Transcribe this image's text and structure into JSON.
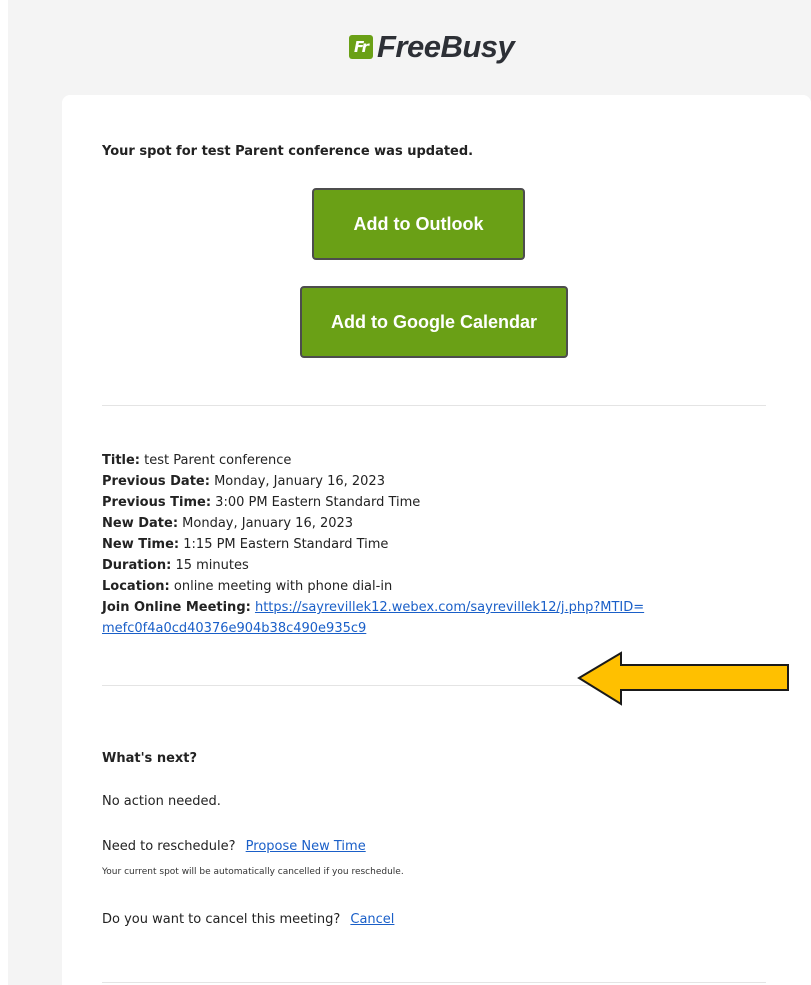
{
  "brand": {
    "mark_glyph": "Fr",
    "name": "FreeBusy",
    "mark_color": "#6aa016"
  },
  "email": {
    "headline": "Your spot for test Parent conference was updated.",
    "buttons": {
      "outlook": "Add to Outlook",
      "google": "Add to Google Calendar"
    },
    "details": {
      "title_label": "Title:",
      "title_value": "test Parent conference",
      "prev_date_label": "Previous Date:",
      "prev_date_value": "Monday, January 16, 2023",
      "prev_time_label": "Previous Time:",
      "prev_time_value": "3:00 PM Eastern Standard Time",
      "new_date_label": "New Date:",
      "new_date_value": "Monday, January 16, 2023",
      "new_time_label": "New Time:",
      "new_time_value": "1:15 PM Eastern Standard Time",
      "duration_label": "Duration:",
      "duration_value": "15 minutes",
      "location_label": "Location:",
      "location_value": "online meeting with phone dial-in",
      "join_label": "Join Online Meeting:",
      "join_url_line1": "https://sayrevillek12.webex.com/sayrevillek12/j.php?MTID=",
      "join_url_line2": "mefc0f4a0cd40376e904b38c490e935c9"
    },
    "next": {
      "heading": "What's next?",
      "no_action": "No action needed.",
      "reschedule_question": "Need to reschedule?",
      "reschedule_link": "Propose New Time",
      "reschedule_note": "Your current spot will be automatically cancelled if you reschedule.",
      "cancel_question": "Do you want to cancel this meeting?",
      "cancel_link": "Cancel"
    }
  },
  "colors": {
    "button_green": "#6aa016",
    "link_blue": "#1a5fc8",
    "arrow_fill": "#ffc000"
  }
}
